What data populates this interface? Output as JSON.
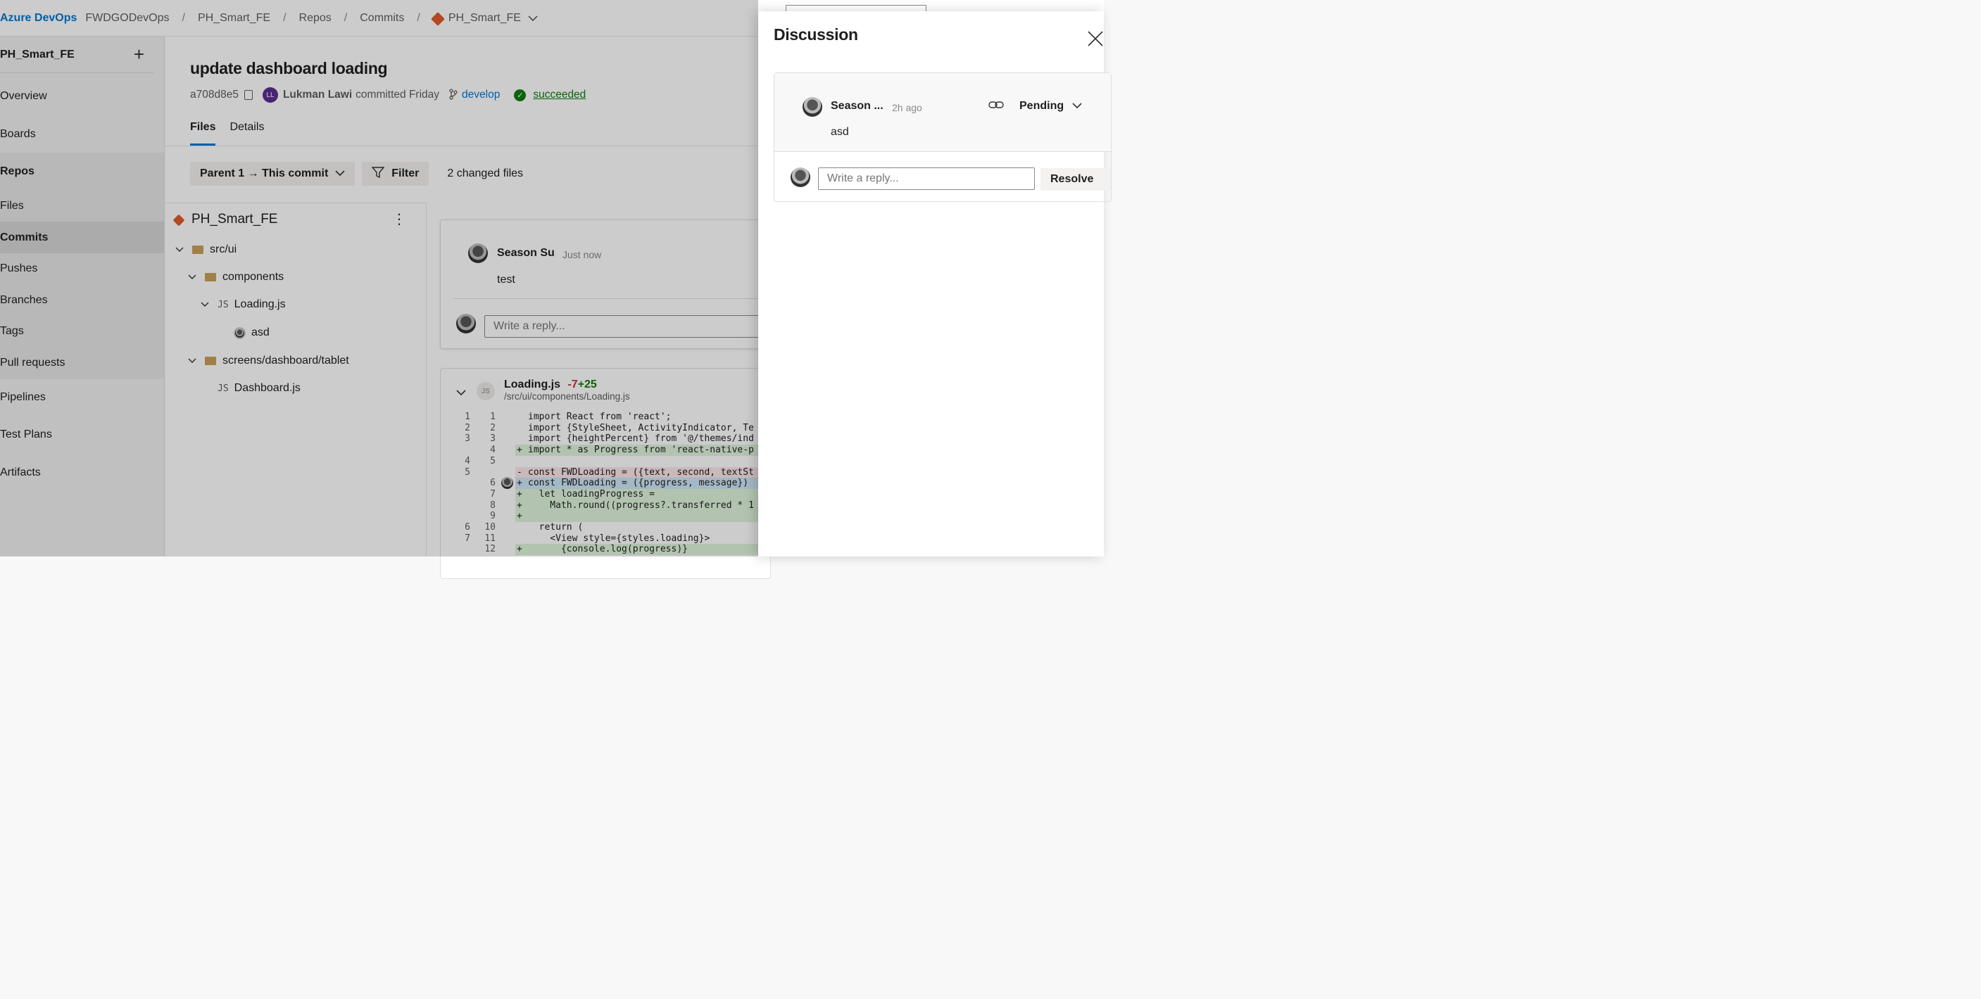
{
  "header": {
    "brand": "Azure DevOps",
    "breadcrumbs": [
      "FWDGODevOps",
      "Repos",
      "Commits"
    ],
    "project": "PH_Smart_FE",
    "repo": "PH_Smart_FE",
    "separator": "/"
  },
  "sidebar": {
    "project": "PH_Smart_FE",
    "items": [
      {
        "label": "Overview"
      },
      {
        "label": "Boards"
      },
      {
        "label": "Repos"
      },
      {
        "label": "Files"
      },
      {
        "label": "Commits"
      },
      {
        "label": "Pushes"
      },
      {
        "label": "Branches"
      },
      {
        "label": "Tags"
      },
      {
        "label": "Pull requests"
      },
      {
        "label": "Pipelines"
      },
      {
        "label": "Test Plans"
      },
      {
        "label": "Artifacts"
      }
    ]
  },
  "commit": {
    "title": "update dashboard loading",
    "hash": "a708d8e5",
    "author_initials": "LL",
    "author": "Lukman Lawi",
    "action": "committed Friday",
    "branch": "develop",
    "status": "succeeded"
  },
  "tabs": [
    "Files",
    "Details"
  ],
  "toolbar": {
    "compare": "Parent 1 → This commit",
    "filter": "Filter",
    "changed": "2 changed files"
  },
  "tree": {
    "root": "PH_Smart_FE",
    "items": [
      {
        "label": "src/ui"
      },
      {
        "label": "components"
      },
      {
        "label": "Loading.js",
        "type": "JS"
      },
      {
        "label": "asd"
      },
      {
        "label": "screens/dashboard/tablet"
      },
      {
        "label": "Dashboard.js",
        "type": "JS"
      }
    ]
  },
  "comment": {
    "author": "Season Su",
    "time": "Just now",
    "text": "test",
    "reply_placeholder": "Write a reply..."
  },
  "diff": {
    "file": "Loading.js",
    "deleted": "-7",
    "added": "+25",
    "path": "/src/ui/components/Loading.js",
    "badge": "JS",
    "lines": [
      {
        "o": "1",
        "n": "1",
        "m": " ",
        "t": "import React from 'react';",
        "k": "ctx"
      },
      {
        "o": "2",
        "n": "2",
        "m": " ",
        "t": "import {StyleSheet, ActivityIndicator, Te",
        "k": "ctx"
      },
      {
        "o": "3",
        "n": "3",
        "m": " ",
        "t": "import {heightPercent} from '@/themes/ind",
        "k": "ctx"
      },
      {
        "o": "",
        "n": "4",
        "m": "+",
        "t": "import * as Progress from 'react-native-p",
        "k": "add"
      },
      {
        "o": "4",
        "n": "5",
        "m": " ",
        "t": "",
        "k": "ctx"
      },
      {
        "o": "5",
        "n": "",
        "m": "-",
        "t": "const FWDLoading = ({text, second, textSt",
        "k": "del"
      },
      {
        "o": "",
        "n": "6",
        "m": "+",
        "t": "const FWDLoading = ({progress, message})",
        "k": "hl"
      },
      {
        "o": "",
        "n": "7",
        "m": "+",
        "t": "  let loadingProgress =",
        "k": "add"
      },
      {
        "o": "",
        "n": "8",
        "m": "+",
        "t": "    Math.round((progress?.transferred * 1",
        "k": "add"
      },
      {
        "o": "",
        "n": "9",
        "m": "+",
        "t": "",
        "k": "add"
      },
      {
        "o": "6",
        "n": "10",
        "m": " ",
        "t": "  return (",
        "k": "ctx"
      },
      {
        "o": "7",
        "n": "11",
        "m": " ",
        "t": "    <View style={styles.loading}>",
        "k": "ctx"
      },
      {
        "o": "",
        "n": "12",
        "m": "+",
        "t": "      {console.log(progress)}",
        "k": "add"
      }
    ]
  },
  "discussion": {
    "title": "Discussion",
    "author": "Season ...",
    "time": "2h ago",
    "status": "Pending",
    "text": "asd",
    "reply_placeholder": "Write a reply...",
    "resolve": "Resolve"
  }
}
